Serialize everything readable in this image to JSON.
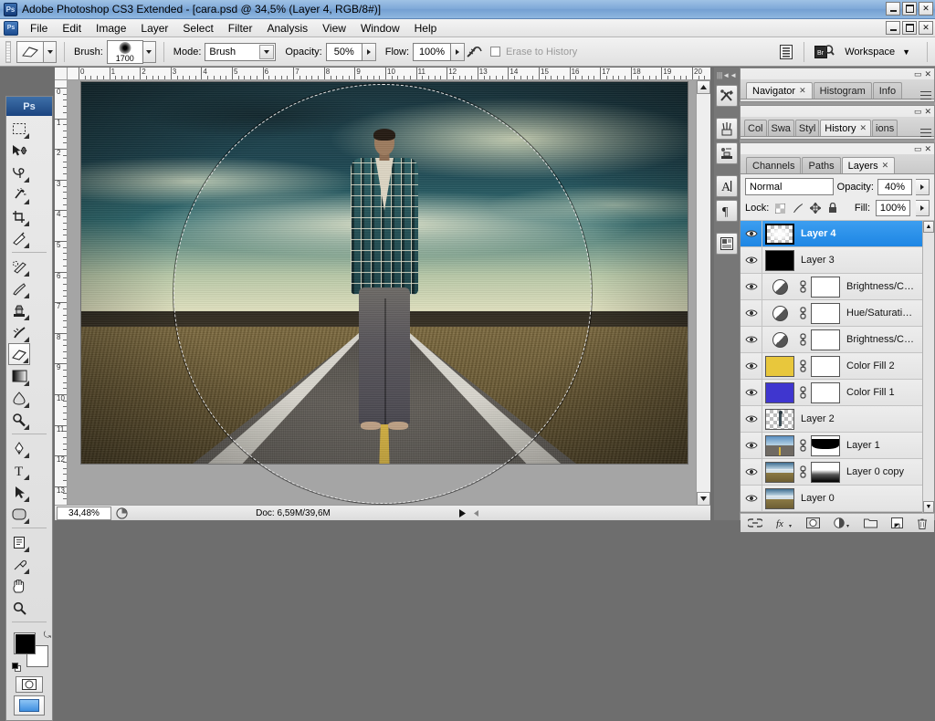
{
  "window": {
    "title": "Adobe Photoshop CS3 Extended - [cara.psd @ 34,5% (Layer 4, RGB/8#)]",
    "app_badge": "Ps"
  },
  "menu": {
    "items": [
      "File",
      "Edit",
      "Image",
      "Layer",
      "Select",
      "Filter",
      "Analysis",
      "View",
      "Window",
      "Help"
    ]
  },
  "options_bar": {
    "tool_icon": "eraser-icon",
    "brush_label": "Brush:",
    "brush_size": "1700",
    "mode_label": "Mode:",
    "mode_value": "Brush",
    "opacity_label": "Opacity:",
    "opacity_value": "50%",
    "flow_label": "Flow:",
    "flow_value": "100%",
    "airbrush_icon": "airbrush-icon",
    "erase_to_history_label": "Erase to History",
    "erase_to_history_checked": false,
    "palettes_icon": "palettes-icon",
    "bridge_icon": "bridge-icon",
    "bridge_label": "Br",
    "workspace_label": "Workspace"
  },
  "toolbox": {
    "badge": "Ps",
    "tools": [
      {
        "name": "marquee-tool",
        "glyph": "marquee"
      },
      {
        "name": "move-tool",
        "glyph": "move"
      },
      {
        "name": "lasso-tool",
        "glyph": "lasso"
      },
      {
        "name": "magic-wand-tool",
        "glyph": "wand"
      },
      {
        "name": "crop-tool",
        "glyph": "crop"
      },
      {
        "name": "slice-tool",
        "glyph": "slice"
      },
      {
        "name": "healing-brush-tool",
        "glyph": "heal"
      },
      {
        "name": "brush-tool",
        "glyph": "brush"
      },
      {
        "name": "clone-stamp-tool",
        "glyph": "stamp"
      },
      {
        "name": "history-brush-tool",
        "glyph": "historybrush"
      },
      {
        "name": "eraser-tool",
        "glyph": "eraser",
        "selected": true
      },
      {
        "name": "gradient-tool",
        "glyph": "gradient"
      },
      {
        "name": "blur-tool",
        "glyph": "blur"
      },
      {
        "name": "dodge-tool",
        "glyph": "dodge"
      },
      {
        "name": "pen-tool",
        "glyph": "pen"
      },
      {
        "name": "type-tool",
        "glyph": "type"
      },
      {
        "name": "path-selection-tool",
        "glyph": "arrow"
      },
      {
        "name": "shape-tool",
        "glyph": "shape"
      },
      {
        "name": "notes-tool",
        "glyph": "notes"
      },
      {
        "name": "eyedropper-tool",
        "glyph": "eyedropper"
      },
      {
        "name": "hand-tool",
        "glyph": "hand"
      },
      {
        "name": "zoom-tool",
        "glyph": "zoom"
      }
    ],
    "foreground_color": "#000000",
    "background_color": "#ffffff",
    "quick_mask_icon": "quick-mask-icon",
    "screen_mode_icon": "screen-mode-icon"
  },
  "document": {
    "ruler_h_labels": [
      "0",
      "1",
      "2",
      "3",
      "4",
      "5",
      "6",
      "7",
      "8",
      "9",
      "10",
      "11",
      "12",
      "13",
      "14",
      "15",
      "16",
      "17",
      "18",
      "19",
      "20"
    ],
    "ruler_v_labels": [
      "0",
      "1",
      "2",
      "3",
      "4",
      "5",
      "6",
      "7",
      "8",
      "9",
      "10",
      "11",
      "12",
      "13"
    ],
    "brush_cursor": "circular-brush-cursor"
  },
  "status_bar": {
    "zoom_value": "34,48%",
    "doc_icon": "document-size-icon",
    "doc_info": "Doc: 6,59M/39,6M"
  },
  "dock_strip": {
    "buttons": [
      {
        "name": "tool-presets-icon",
        "glyph": "tools"
      },
      {
        "name": "brushes-icon",
        "glyph": "brushes"
      },
      {
        "name": "clone-source-icon",
        "glyph": "clone"
      },
      {
        "name": "character-icon",
        "glyph": "A"
      },
      {
        "name": "paragraph-icon",
        "glyph": "¶"
      },
      {
        "name": "layer-comps-icon",
        "glyph": "comps"
      }
    ]
  },
  "panels": {
    "group1_tabs": [
      {
        "label": "Navigator",
        "active": true,
        "closable": true
      },
      {
        "label": "Histogram",
        "active": false,
        "closable": false
      },
      {
        "label": "Info",
        "active": false,
        "closable": false
      }
    ],
    "group2_tabs": [
      {
        "label": "Col",
        "active": false,
        "closable": false
      },
      {
        "label": "Swa",
        "active": false,
        "closable": false
      },
      {
        "label": "Styl",
        "active": false,
        "closable": false
      },
      {
        "label": "History",
        "active": true,
        "closable": true
      },
      {
        "label": "ions",
        "active": false,
        "closable": false
      }
    ],
    "group3_tabs": [
      {
        "label": "Channels",
        "active": false,
        "closable": false
      },
      {
        "label": "Paths",
        "active": false,
        "closable": false
      },
      {
        "label": "Layers",
        "active": true,
        "closable": true
      }
    ]
  },
  "layers_panel": {
    "blend_mode": "Normal",
    "opacity_label": "Opacity:",
    "opacity_value": "40%",
    "lock_label": "Lock:",
    "fill_label": "Fill:",
    "fill_value": "100%",
    "lock_icons": [
      "lock-transparency-icon",
      "lock-image-icon",
      "lock-position-icon",
      "lock-all-icon"
    ],
    "layers": [
      {
        "name": "Layer 4",
        "selected": true,
        "thumb": "checker-soft",
        "mask": null,
        "link": false,
        "visible": true
      },
      {
        "name": "Layer 3",
        "selected": false,
        "thumb": "black",
        "mask": null,
        "link": false,
        "visible": true
      },
      {
        "name": "Brightness/C…",
        "selected": false,
        "thumb": "adjustment",
        "mask": "white",
        "link": true,
        "visible": true
      },
      {
        "name": "Hue/Saturati…",
        "selected": false,
        "thumb": "adjustment",
        "mask": "white",
        "link": true,
        "visible": true
      },
      {
        "name": "Brightness/C…",
        "selected": false,
        "thumb": "adjustment",
        "mask": "white",
        "link": true,
        "visible": true
      },
      {
        "name": "Color Fill 2",
        "selected": false,
        "thumb": "#e8c73c",
        "mask": "white",
        "link": true,
        "visible": true
      },
      {
        "name": "Color Fill 1",
        "selected": false,
        "thumb": "#3f36cf",
        "mask": "white",
        "link": true,
        "visible": true
      },
      {
        "name": "Layer 2",
        "selected": false,
        "thumb": "person",
        "mask": null,
        "link": false,
        "visible": true
      },
      {
        "name": "Layer 1",
        "selected": false,
        "thumb": "road",
        "mask": "black-mid",
        "link": true,
        "visible": true
      },
      {
        "name": "Layer 0 copy",
        "selected": false,
        "thumb": "landscape",
        "mask": "gradient",
        "link": true,
        "visible": true
      },
      {
        "name": "Layer 0",
        "selected": false,
        "thumb": "landscape",
        "mask": null,
        "link": false,
        "visible": true
      }
    ],
    "bottom_buttons": [
      {
        "name": "link-layers-button",
        "glyph": "link"
      },
      {
        "name": "layer-style-button",
        "glyph": "fx"
      },
      {
        "name": "add-mask-button",
        "glyph": "mask"
      },
      {
        "name": "new-adjustment-button",
        "glyph": "adj"
      },
      {
        "name": "new-group-button",
        "glyph": "folder"
      },
      {
        "name": "new-layer-button",
        "glyph": "newlayer"
      },
      {
        "name": "delete-layer-button",
        "glyph": "trash"
      }
    ]
  },
  "colors": {
    "title_bar": "#8fb7e0",
    "selection_blue": "#2a8ee8",
    "panel_bg": "#e7e7e7",
    "canvas_bg": "#a5a5a5"
  }
}
